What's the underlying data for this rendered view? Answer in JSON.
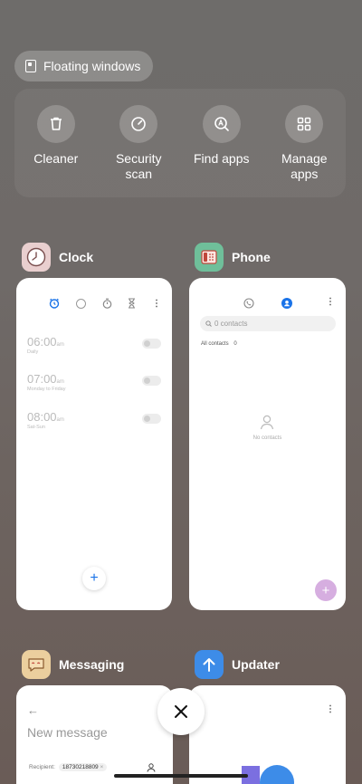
{
  "floating_windows": {
    "label": "Floating windows",
    "icon": "floating-window-icon"
  },
  "tools": [
    {
      "label": "Cleaner",
      "icon": "trash-icon"
    },
    {
      "label": "Security\nscan",
      "icon": "gauge-icon"
    },
    {
      "label": "Find apps",
      "icon": "find-apps-icon"
    },
    {
      "label": "Manage\napps",
      "icon": "grid-icon"
    }
  ],
  "apps": {
    "clock": {
      "title": "Clock",
      "alarms": [
        {
          "time": "06:00",
          "ampm": "am",
          "repeat": "Daily"
        },
        {
          "time": "07:00",
          "ampm": "am",
          "repeat": "Monday to Friday"
        },
        {
          "time": "08:00",
          "ampm": "am",
          "repeat": "Sat-Sun"
        }
      ],
      "add": "+"
    },
    "phone": {
      "title": "Phone",
      "search_placeholder": "0 contacts",
      "filter": "All contacts",
      "filter_count": "0",
      "empty": "No contacts",
      "add": "+"
    },
    "messaging": {
      "title": "Messaging",
      "back": "←",
      "heading": "New message",
      "recipient_label": "Recipient:",
      "recipient_chip": "18730218809",
      "chip_x": "×"
    },
    "updater": {
      "title": "Updater",
      "more": "⋮"
    }
  },
  "close_label": "×",
  "colors": {
    "accent": "#1a73e8",
    "phone_fab": "#d6aee0",
    "updater_blue": "#3d8ce8"
  }
}
